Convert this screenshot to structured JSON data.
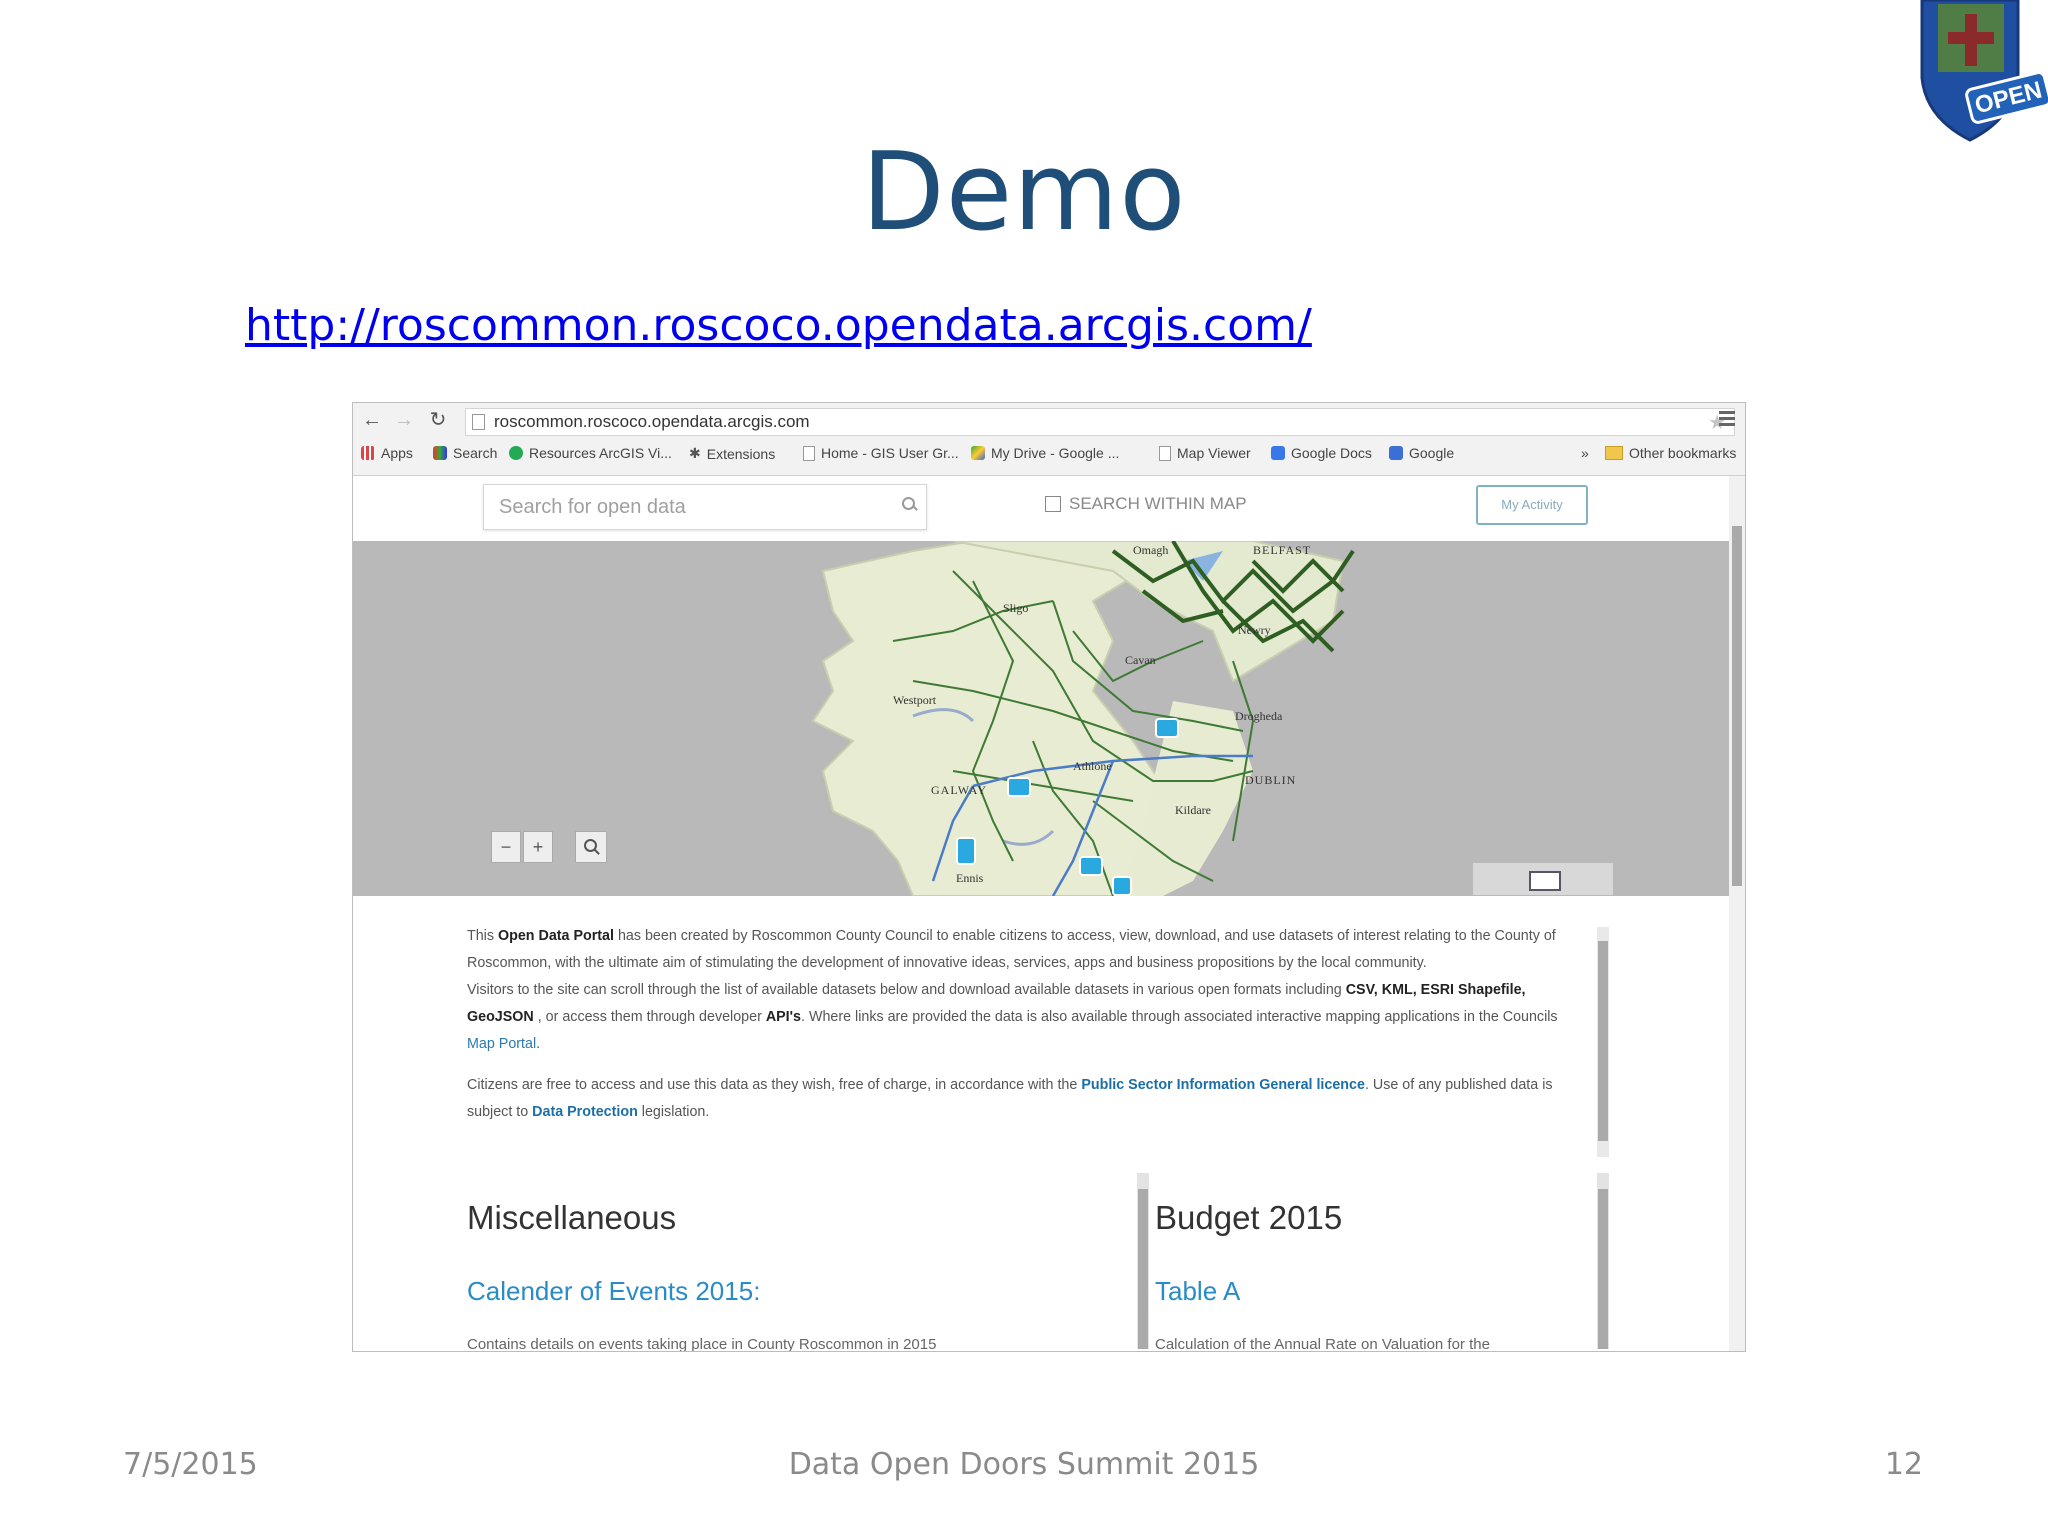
{
  "slide": {
    "title": "Demo",
    "link": "http://roscommon.roscoco.opendata.arcgis.com/",
    "logo_text": "OPEN",
    "footer_date": "7/5/2015",
    "footer_title": "Data Open Doors Summit 2015",
    "footer_page": "12"
  },
  "browser": {
    "url": "roscommon.roscoco.opendata.arcgis.com",
    "bookmarks": [
      "Apps",
      "Search",
      "Resources ArcGIS Vi...",
      "Extensions",
      "Home - GIS User Gr...",
      "My Drive - Google ...",
      "Map Viewer",
      "Google Docs",
      "Google"
    ],
    "other_bookmarks": "Other bookmarks",
    "overflow": "»"
  },
  "portal": {
    "search_placeholder": "Search for open data",
    "search_within_map": "SEARCH WITHIN MAP",
    "my_activity": "My Activity",
    "zoom_out": "−",
    "zoom_in": "+",
    "map_labels": [
      "BELFAST",
      "Omagh",
      "Sligo",
      "Newry",
      "Cavan",
      "Westport",
      "Drogheda",
      "Athlone",
      "DUBLIN",
      "GALWAY",
      "Kildare",
      "Ennis"
    ]
  },
  "intro": {
    "p1_pre": "This ",
    "p1_bold": "Open Data Portal",
    "p1_post": " has been created by Roscommon County Council to enable citizens to access, view, download, and use datasets of interest relating to the County of Roscommon, with the ultimate aim of stimulating the development of innovative ideas, services, apps and business propositions by the local community.",
    "p2_pre": "Visitors to the site can scroll through the list of available datasets below and download available datasets in various open formats including ",
    "p2_formats": "CSV, KML, ESRI Shapefile, GeoJSON",
    "p2_mid": " , or access them through developer ",
    "p2_api": "API's",
    "p2_post": ". Where links are provided the data is also available through associated interactive mapping applications in the Councils ",
    "p2_link": "Map Portal",
    "p2_end": ".",
    "p3_pre": "Citizens are free to access and use this data as they wish, free of charge, in accordance with the ",
    "p3_link": "Public Sector Information General licence",
    "p3_mid": ". Use of any published data is subject to ",
    "p3_link2": "Data Protection",
    "p3_end": " legislation."
  },
  "sections": {
    "left_title": "Miscellaneous",
    "left_link": "Calender of Events 2015:",
    "left_desc": "Contains details on events taking place in County Roscommon in 2015",
    "right_title": "Budget 2015",
    "right_link": "Table A",
    "right_desc": "Calculation of the Annual Rate on Valuation for the"
  }
}
